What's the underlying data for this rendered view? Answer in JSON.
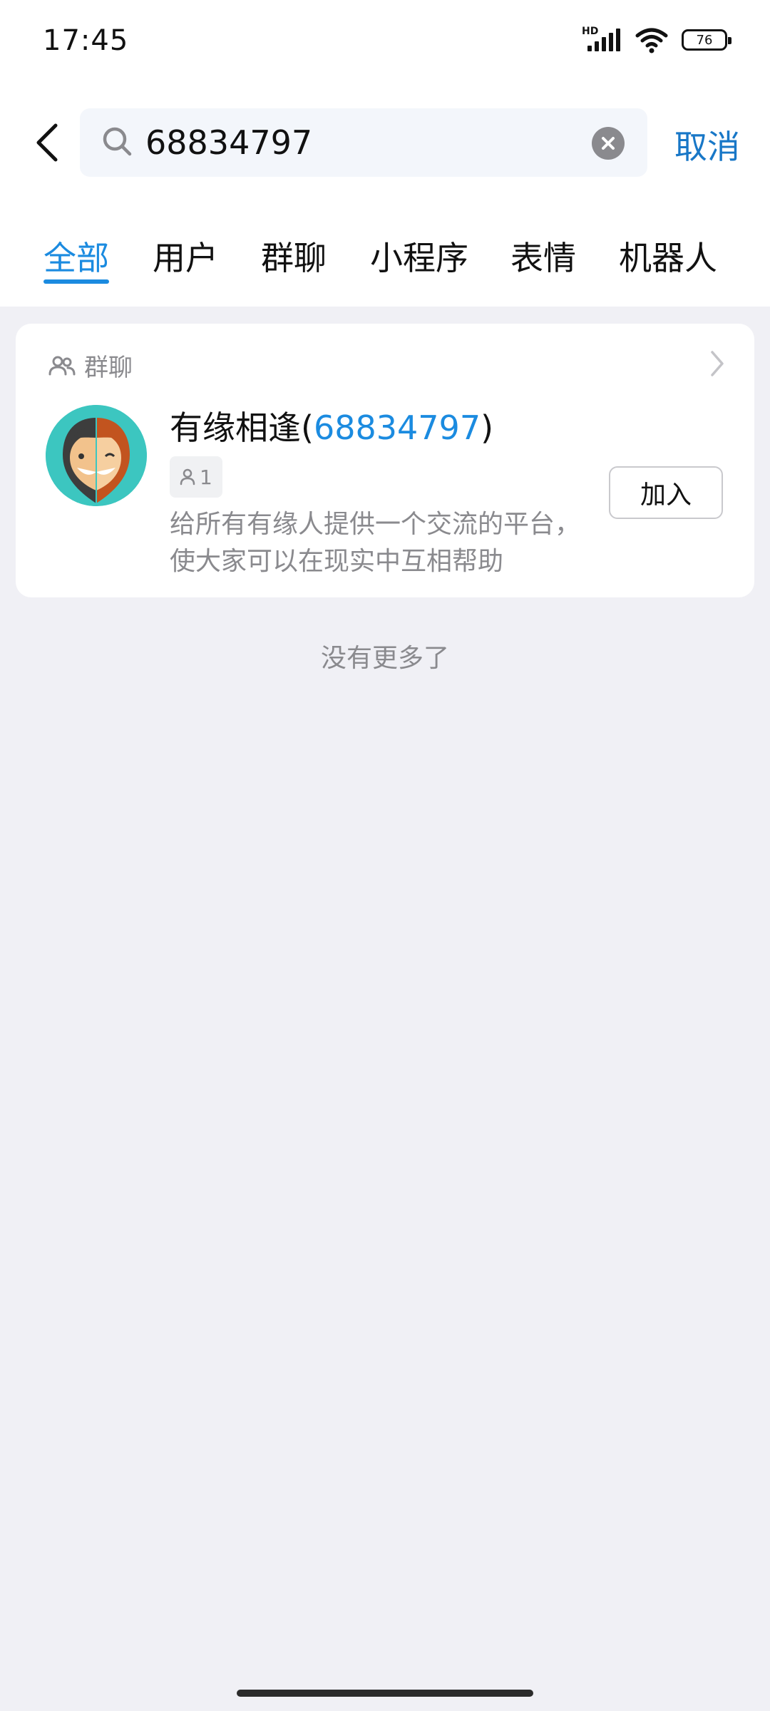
{
  "status_bar": {
    "time": "17:45",
    "network_label": "HD",
    "battery": "76",
    "icons": [
      "signal-icon",
      "wifi-icon",
      "battery-icon"
    ]
  },
  "search": {
    "query": "68834797",
    "cancel_label": "取消"
  },
  "tabs": [
    {
      "label": "全部",
      "active": true
    },
    {
      "label": "用户",
      "active": false
    },
    {
      "label": "群聊",
      "active": false
    },
    {
      "label": "小程序",
      "active": false
    },
    {
      "label": "表情",
      "active": false
    },
    {
      "label": "机器人",
      "active": false
    }
  ],
  "results": {
    "section_label": "群聊",
    "group": {
      "name_prefix": "有缘相逢(",
      "name_id": "68834797",
      "name_suffix": ")",
      "member_count": "1",
      "description": "给所有有缘人提供一个交流的平台，使大家可以在现实中互相帮助",
      "join_label": "加入"
    }
  },
  "footer": {
    "no_more": "没有更多了"
  },
  "colors": {
    "accent": "#1b8be0",
    "cancel": "#1877c7",
    "background": "#f0f0f5",
    "avatar_bg": "#3cc6c0"
  }
}
